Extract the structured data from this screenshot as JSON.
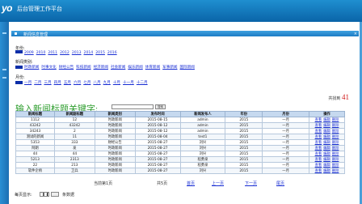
{
  "app": {
    "logo": "yo",
    "title": "后台管理工作平台",
    "top_links": "您好 | 退出"
  },
  "panel": {
    "title": "新闻信息管理",
    "close": "×"
  },
  "filters": {
    "year_label": "年份:",
    "years": [
      "2009",
      "2010",
      "2011",
      "2012",
      "2013",
      "2014",
      "2015",
      "2016"
    ],
    "category_label": "新闻类别:",
    "categories": [
      "时政新闻",
      "时事文化",
      "财经公告",
      "科技新闻",
      "经济新闻",
      "社会新闻",
      "娱乐新闻",
      "体育新闻",
      "军事新闻",
      "国际新闻"
    ],
    "month_label": "月份:",
    "months": [
      "一月",
      "二月",
      "三月",
      "四月",
      "五月",
      "六月",
      "七月",
      "八月",
      "九月",
      "十月",
      "十一月",
      "十二月"
    ]
  },
  "summary": {
    "total_label": "共找到",
    "total_count": "41"
  },
  "search": {
    "title": "输入新闻标题关键字:",
    "placeholder": "",
    "button": "搜索"
  },
  "table": {
    "headers": [
      "新闻标题",
      "新闻副标题",
      "新闻类别",
      "发布时间",
      "新闻发布人",
      "年份",
      "月份",
      "操作"
    ],
    "rows": [
      [
        "1112",
        "12",
        "时政新闻",
        "2015-08-15",
        "admin",
        "2015",
        "一月"
      ],
      [
        "43242",
        "43242",
        "时政新闻",
        "2015-08-12",
        "admin",
        "2015",
        "一月"
      ],
      [
        "34243",
        "2",
        "时政新闻",
        "2015-08-12",
        "admin",
        "2015",
        "一月"
      ],
      [
        "测试的新闻",
        "11",
        "时政新闻",
        "2015-08-04",
        "test1",
        "2015",
        "一月"
      ],
      [
        "5353",
        "333",
        "财经公告",
        "2015-08-27",
        "刘兴",
        "2015",
        "一月"
      ],
      [
        "阿朗",
        "发",
        "时政新闻",
        "2015-08-27",
        "刘兴",
        "2015",
        "一月"
      ],
      [
        "44",
        "44",
        "时政新闻",
        "2015-08-27",
        "刘兴",
        "2015",
        "一月"
      ],
      [
        "5213",
        "2313",
        "时政新闻",
        "2015-08-27",
        "程勇泉",
        "2015",
        "一月"
      ],
      [
        "22",
        "213",
        "时政新闻",
        "2015-08-27",
        "程勇泉",
        "2015",
        "一月"
      ],
      [
        "软件企杨",
        "卫兵",
        "时政新闻",
        "2015-08-27",
        "刘兴",
        "2015",
        "一月"
      ]
    ],
    "actions": [
      "查看",
      "编辑",
      "删除"
    ]
  },
  "pager": {
    "current": "当前第1页",
    "total_pages": "共5页",
    "first": "首页",
    "prev": "上一页",
    "next": "下一页",
    "last": "尾页"
  },
  "goto": {
    "label": "每页显示:",
    "value": "10",
    "unit": "条数据"
  }
}
